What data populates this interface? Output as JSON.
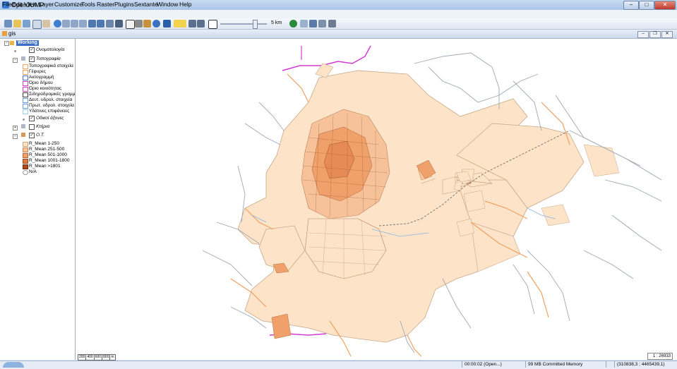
{
  "window": {
    "title": "OpenJUMP",
    "controls": {
      "minimize": "–",
      "maximize": "□",
      "close": "✕"
    }
  },
  "menu": [
    "File",
    "Edit",
    "View",
    "Layer",
    "Customize",
    "Tools",
    "Raster",
    "Plugins",
    "Sextante",
    "Window",
    "Help"
  ],
  "toolbar": {
    "scale_label": "5 km"
  },
  "frame": {
    "title": "gis"
  },
  "layers": {
    "category_working": "Working",
    "onomatologia": "Ονοματολογία",
    "topografia": "Τοπογραφία",
    "topo_items": [
      "Τοπογραφικά στοιχεία",
      "Γέφυρες",
      "Ακτογραμμή",
      "Όριο δήμου",
      "Όριο κοινότητας",
      "Σιδηροδρομικές γραμμ",
      "Δευτ. υδρολ. στοιχεία",
      "Πρωτ. υδρολ. στοιχεία",
      "Υδάτινες επιφάνειες"
    ],
    "odiko": "Οδικοί άξονες",
    "ktiria": "Κτήρια",
    "ot": "Ο.Τ.",
    "legend": [
      "R_Mean 1-250",
      "R_Mean 251-500",
      "R_Mean 501-1000",
      "R_Mean 1001-1800",
      "R_Mean >1801",
      "N/A"
    ]
  },
  "colors": {
    "legend_fill": [
      "#fde3c8",
      "#f9c59a",
      "#f0a06a",
      "#e07a45",
      "#b04a1f",
      "#ffffff"
    ],
    "topo_swatch": [
      "#f4a460",
      "#e8a060",
      "#4a6fd1",
      "#d040c0",
      "#d040c0",
      "#404040",
      "#6a9be0",
      "#6a9be0",
      "#9fd0f0"
    ]
  },
  "map": {
    "scalebar_ticks": [
      "200",
      "400",
      "600",
      "800",
      "m"
    ],
    "scale_readout": "1 : 26933"
  },
  "status": {
    "timer": "00:00:02 (Open...)",
    "memory": "99 MB Committed Memory",
    "coords": "(310838,3 ; 4465439,1)"
  }
}
